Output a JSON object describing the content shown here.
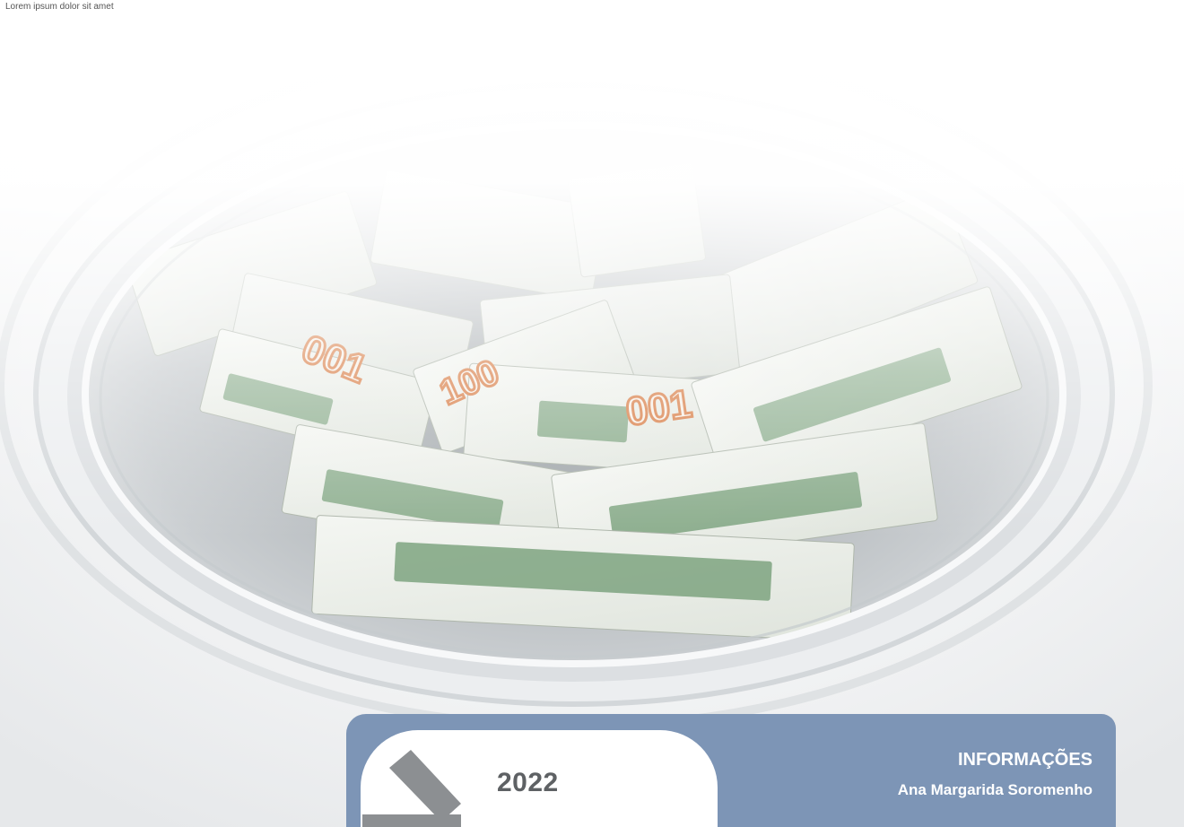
{
  "credit": "Lorem ipsum dolor sit amet",
  "photo": {
    "subject": "washing-machine-with-banknotes",
    "note_denomination": "100"
  },
  "panel": {
    "year": "2022",
    "title": "INFORMAÇÕES",
    "author": "Ana Margarida Soromenho"
  },
  "colors": {
    "panel": "#7d95b6",
    "year_text": "#5e6164",
    "arrow": "#8c8f92",
    "note_green": "#6f9a72",
    "note_orange": "#d9804a"
  }
}
